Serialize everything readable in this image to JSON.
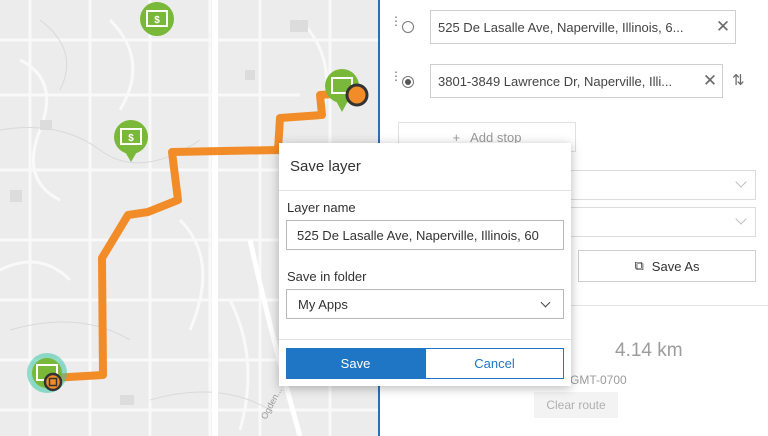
{
  "route_panel": {
    "stops": [
      {
        "address": "525 De Lasalle Ave, Naperville, Illinois, 6...",
        "selected": false
      },
      {
        "address": "3801-3849 Lawrence Dr, Naperville, Illi...",
        "selected": true
      }
    ],
    "add_stop_label": "Add stop",
    "save_as_label": "Save As",
    "distance": "4.14 km",
    "timezone": "GMT-0700",
    "clear_route_label": "Clear route"
  },
  "save_layer_dialog": {
    "title": "Save layer",
    "layer_name_label": "Layer name",
    "layer_name_value": "525 De Lasalle Ave, Naperville, Illinois, 60",
    "folder_label": "Save in folder",
    "folder_value": "My Apps",
    "save_label": "Save",
    "cancel_label": "Cancel"
  },
  "map": {
    "route_color": "#f28c28",
    "poi_color": "#7ab83a",
    "road_label": "Ogden..."
  },
  "colors": {
    "accent": "#1f76c4",
    "panel_divider": "#2f6db5"
  },
  "icons": [
    "drag-handle-icon",
    "radio-icon",
    "close-icon",
    "swap-icon",
    "plus-icon",
    "chevron-down-icon",
    "copy-icon",
    "bank-marker-icon"
  ]
}
